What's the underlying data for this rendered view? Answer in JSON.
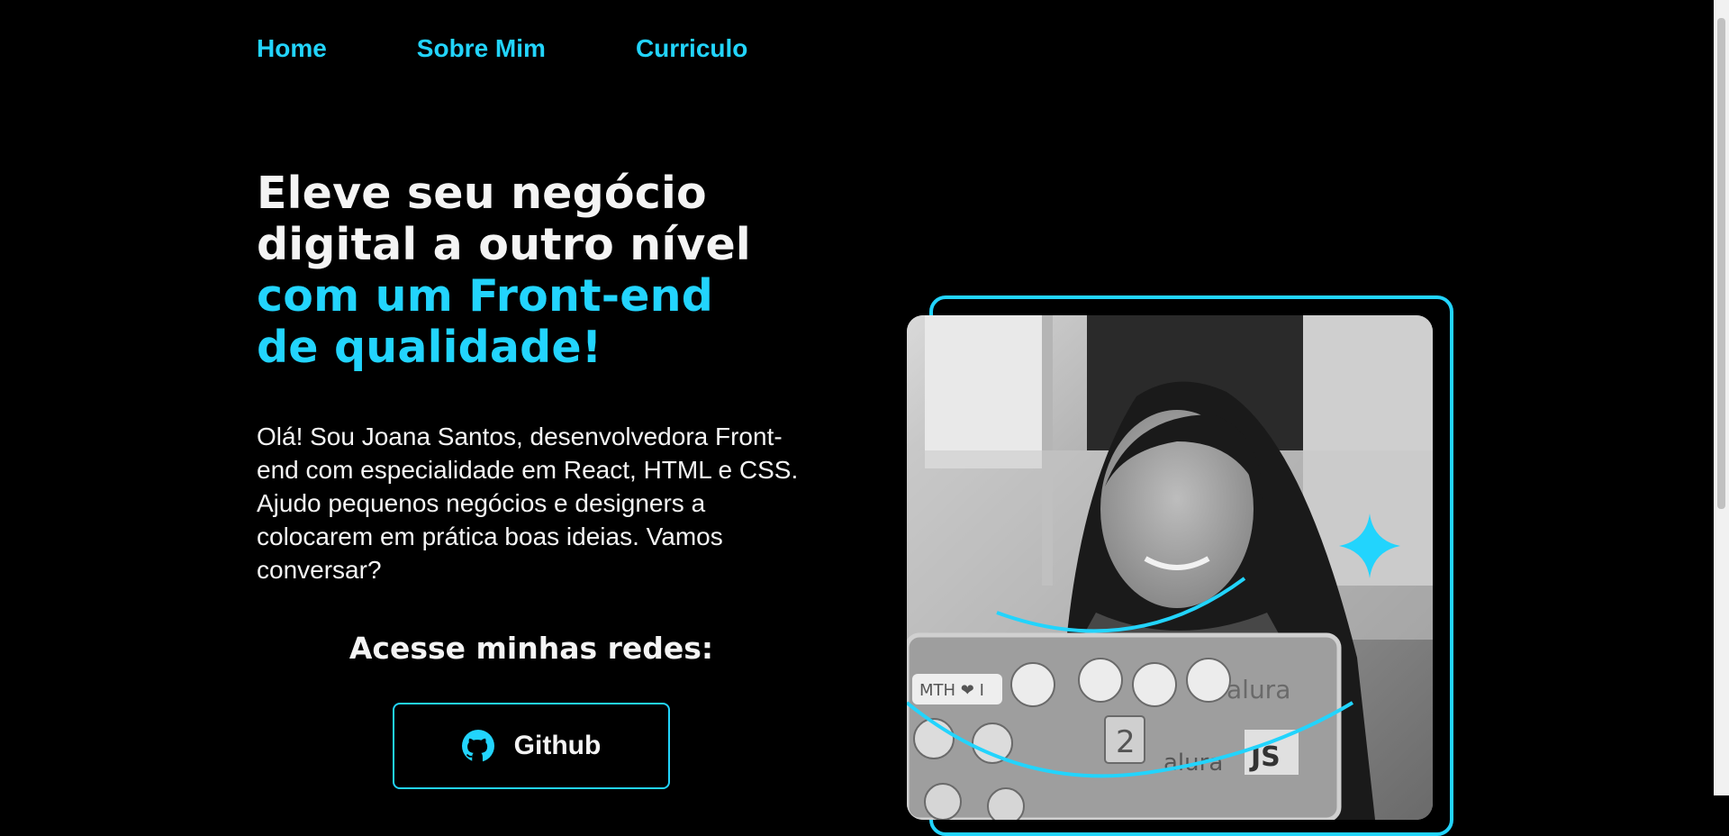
{
  "nav": {
    "items": [
      "Home",
      "Sobre Mim",
      "Curriculo"
    ]
  },
  "hero": {
    "title_white_1": "Eleve seu negócio",
    "title_white_2": "digital a outro nível",
    "title_accent_1": "com um Front-end",
    "title_accent_2": "de qualidade!",
    "intro": "Olá! Sou Joana Santos, desenvolvedora Front-end com especialidade em React, HTML e CSS. Ajudo pequenos negócios e designers a colocarem em prática boas ideias. Vamos conversar?"
  },
  "social": {
    "heading": "Acesse minhas redes:",
    "github_label": "Github",
    "github_icon": "github-icon"
  },
  "photo": {
    "laptop_stickers": [
      "MTH ❤ I",
      "alura",
      "alura",
      "JS",
      "2"
    ]
  },
  "colors": {
    "accent": "#22d4fd",
    "background": "#000000",
    "text": "#f4f4f4"
  }
}
